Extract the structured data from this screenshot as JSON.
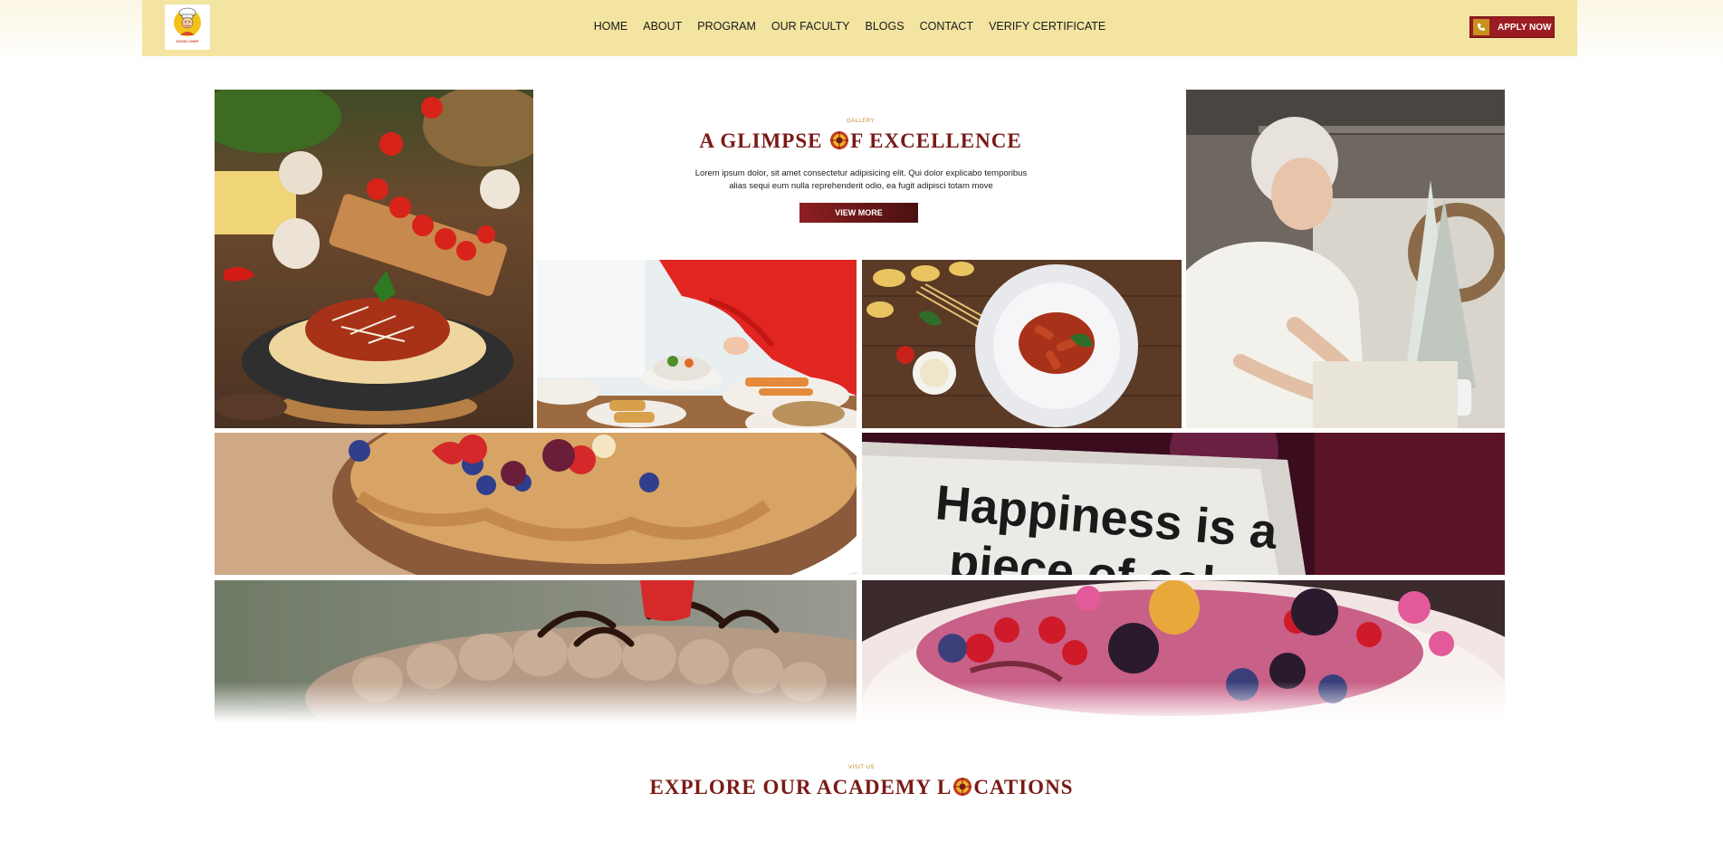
{
  "header": {
    "logo_text": "GOOD CHEF",
    "nav": [
      "HOME",
      "ABOUT",
      "PROGRAM",
      "OUR FACULTY",
      "BLOGS",
      "CONTACT",
      "VERIFY CERTIFICATE"
    ],
    "apply_label": "APPLY NOW",
    "apply_icon": "phone-icon"
  },
  "gallery": {
    "eyebrow": "GALLERY",
    "title_before": "A GLIMPSE ",
    "title_after": "F EXCELLENCE",
    "description": "Lorem ipsum dolor, sit amet consectetur adipisicing elit. Qui dolor explicabo temporibus alias sequi eum nulla reprehenderit odio, ea fugit adipisci totam move",
    "button_label": "VIEW MORE",
    "images": [
      "spaghetti-bolognese-photo",
      "chef-serving-dishes-photo",
      "penne-arrabbiata-plate-photo",
      "senior-woman-cooking-photo",
      "caramel-berry-cake-photo",
      "happiness-cake-sign-photo",
      "chocolate-cream-cake-photo",
      "berry-dessert-plate-photo"
    ],
    "sign_text_line1": "Happiness is a",
    "sign_text_line2": "piece of cake"
  },
  "locations": {
    "eyebrow": "VISIT US",
    "title_before": "EXPLORE OUR ACADEMY L",
    "title_after": "CATIONS"
  },
  "colors": {
    "header_bg": "#f3e4a1",
    "brand_red": "#7a1a16",
    "accent_gold": "#c48a2a",
    "button_red": "#9b1c22"
  }
}
